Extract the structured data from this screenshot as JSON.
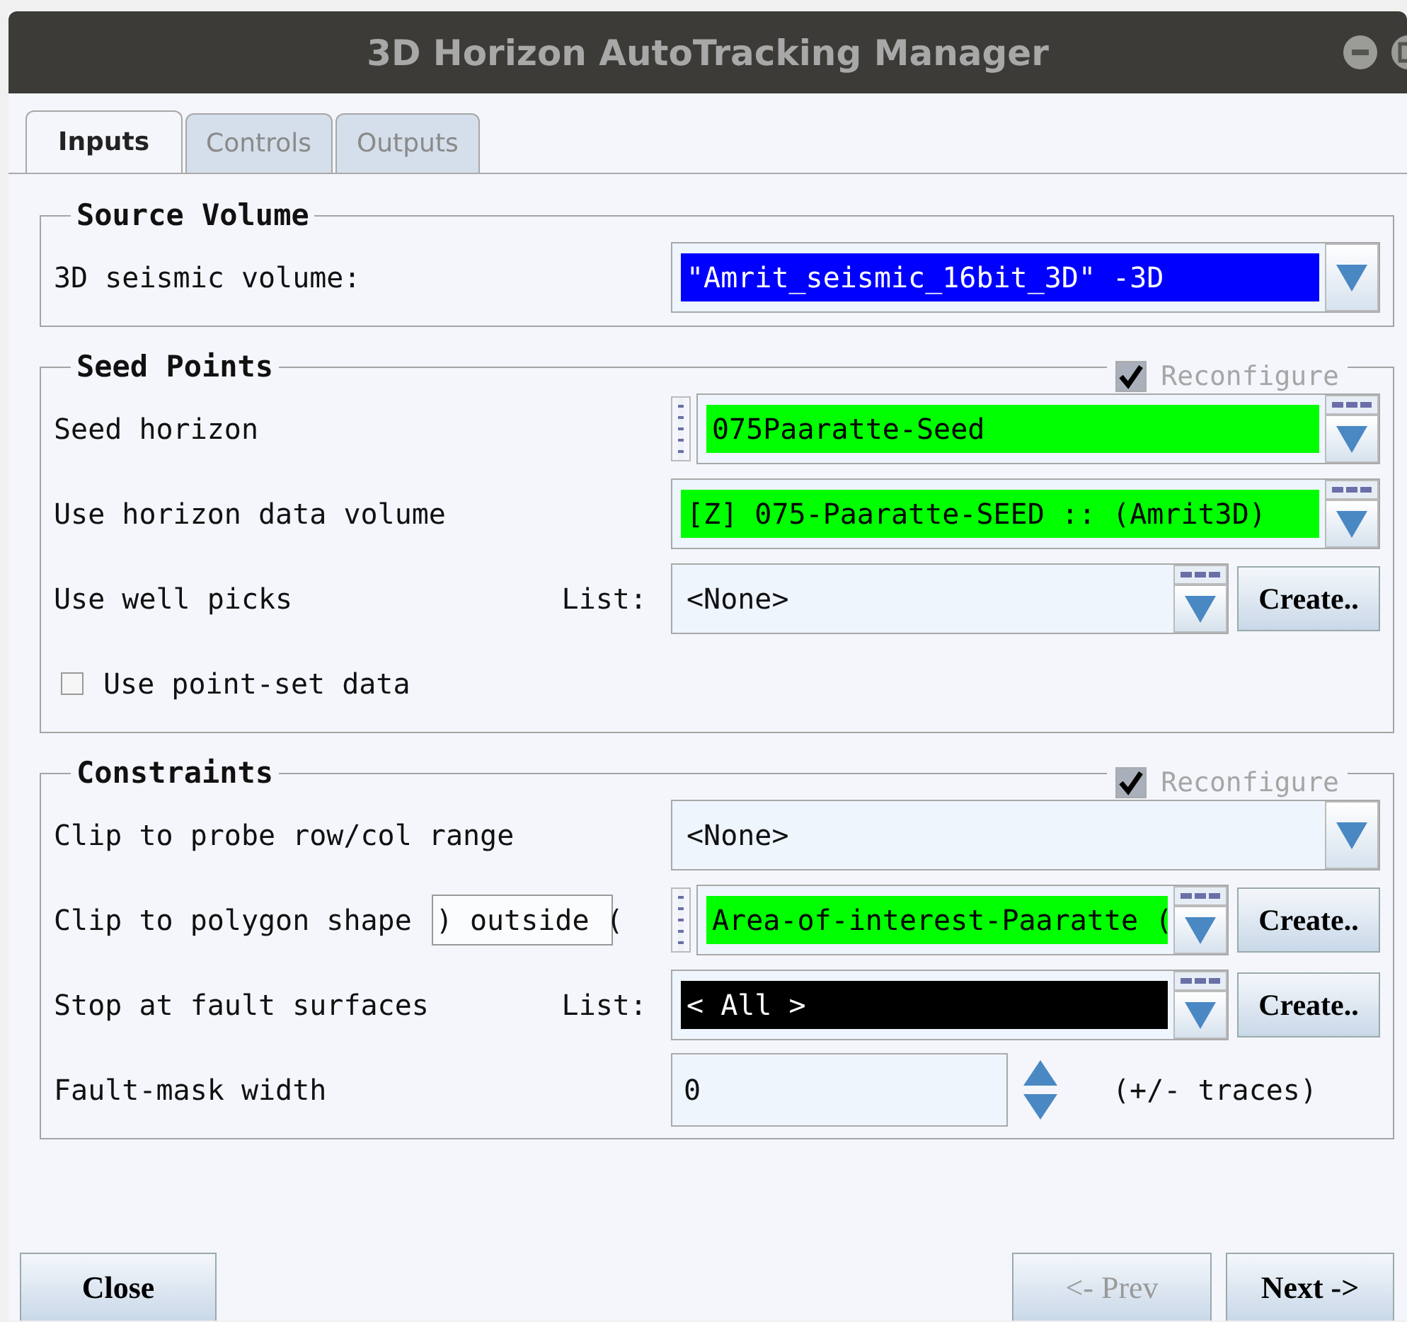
{
  "window": {
    "title": "3D Horizon AutoTracking Manager"
  },
  "tabs": [
    {
      "label": "Inputs",
      "selected": true,
      "disabled": false
    },
    {
      "label": "Controls",
      "selected": false,
      "disabled": true
    },
    {
      "label": "Outputs",
      "selected": false,
      "disabled": true
    }
  ],
  "groups": [
    {
      "title": "Source Volume",
      "rows": [
        {
          "kind": "combo",
          "label": "3D seismic volume:",
          "value": "\"Amrit_seismic_16bit_3D\" -3D",
          "color": "#0000ff",
          "grip": false,
          "list_button": false
        }
      ]
    },
    {
      "title": "Seed Points",
      "reconfigure": {
        "label": "Reconfigure",
        "checked": true,
        "disabled": true
      },
      "rows": [
        {
          "kind": "combo",
          "label": "Seed horizon",
          "value": "075Paaratte-Seed",
          "color": "#00ff00",
          "grip": true,
          "list_button": true
        },
        {
          "kind": "combo",
          "label": "Use horizon data volume",
          "value": "[Z] 075-Paaratte-SEED :: (Amrit3D)",
          "color": "#00ff00",
          "grip": false,
          "list_button": true
        },
        {
          "kind": "combo",
          "label": "Use well picks",
          "list_label": "List:",
          "value": "<None>",
          "grip": false,
          "list_button": true,
          "create_button": "Create.."
        },
        {
          "kind": "checkbox",
          "label": "Use point-set data",
          "checked": false
        }
      ]
    },
    {
      "title": "Constraints",
      "reconfigure": {
        "label": "Reconfigure",
        "checked": true,
        "disabled": true
      },
      "rows": [
        {
          "kind": "combo",
          "label": "Clip to probe row/col range",
          "value": "<None>",
          "grip": false,
          "list_button": false
        },
        {
          "kind": "combo",
          "label": "Clip to polygon shape",
          "extra_field": ") outside (",
          "value": "Area-of-interest-Paaratte (",
          "color": "#00ff00",
          "grip": true,
          "list_button": true,
          "create_button": "Create.."
        },
        {
          "kind": "combo",
          "label": "Stop at fault surfaces",
          "list_label": "List:",
          "value": "< All >",
          "color": "#000000",
          "grip": false,
          "list_button": true,
          "create_button": "Create.."
        },
        {
          "kind": "spinner",
          "label": "Fault-mask width",
          "value": "0",
          "unit": "(+/- traces)"
        }
      ]
    }
  ],
  "buttons": [
    {
      "label": "Close",
      "disabled": false
    },
    {
      "label": "<- Prev",
      "disabled": true
    },
    {
      "label": "Next ->",
      "disabled": false
    }
  ]
}
